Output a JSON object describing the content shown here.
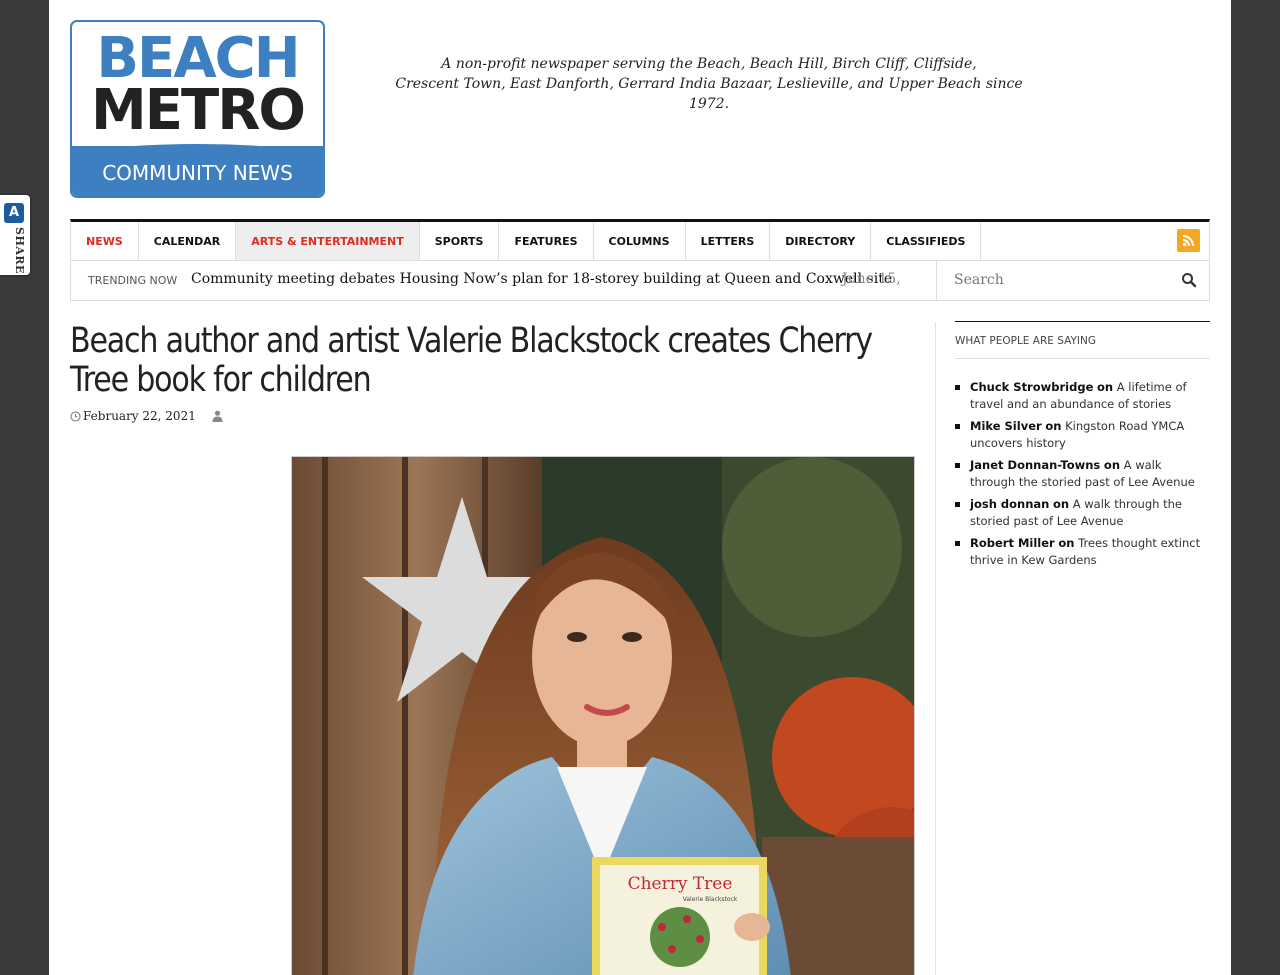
{
  "share": {
    "label": "SHARE",
    "icon": "share-service-icon"
  },
  "logo": {
    "line1": "BEACH",
    "line2": "METRO",
    "line3": "COMMUNITY NEWS"
  },
  "tagline": {
    "line1": "A non-profit newspaper serving the Beach, Beach Hill, Birch Cliff, Cliffside,",
    "line2": "Crescent Town, East Danforth, Gerrard India Bazaar, Leslieville, and Upper Beach since 1972."
  },
  "nav": {
    "items": [
      {
        "label": "NEWS"
      },
      {
        "label": "CALENDAR"
      },
      {
        "label": "ARTS & ENTERTAINMENT"
      },
      {
        "label": "SPORTS"
      },
      {
        "label": "FEATURES"
      },
      {
        "label": "COLUMNS"
      },
      {
        "label": "LETTERS"
      },
      {
        "label": "DIRECTORY"
      },
      {
        "label": "CLASSIFIEDS"
      }
    ],
    "rss_icon": "rss-icon"
  },
  "trending": {
    "label": "TRENDING NOW",
    "headline": "Community meeting debates Housing Now’s plan for 18-storey building at Queen and Coxwell site",
    "date": "June 15,"
  },
  "search": {
    "placeholder": "Search"
  },
  "article": {
    "title": "Beach author and artist Valerie Blackstock creates Cherry Tree book for children",
    "date": "February 22, 2021",
    "book_title": "Cherry Tree",
    "book_author": "Valerie Blackstock"
  },
  "sidebar": {
    "heading": "WHAT PEOPLE ARE SAYING",
    "comments": [
      {
        "author": "Chuck Strowbridge",
        "on": "on",
        "post": "A lifetime of travel and an abundance of stories"
      },
      {
        "author": "Mike Silver",
        "on": "on",
        "post": "Kingston Road YMCA uncovers history"
      },
      {
        "author": "Janet Donnan-Towns",
        "on": "on",
        "post": "A walk through the storied past of Lee Avenue"
      },
      {
        "author": "josh donnan",
        "on": "on",
        "post": "A walk through the storied past of Lee Avenue"
      },
      {
        "author": "Robert Miller",
        "on": "on",
        "post": "Trees thought extinct thrive in Kew Gardens"
      }
    ]
  },
  "colors": {
    "brand_blue": "#3d7fc0",
    "nav_red": "#e22b1f",
    "rss_orange": "#f5a623"
  }
}
